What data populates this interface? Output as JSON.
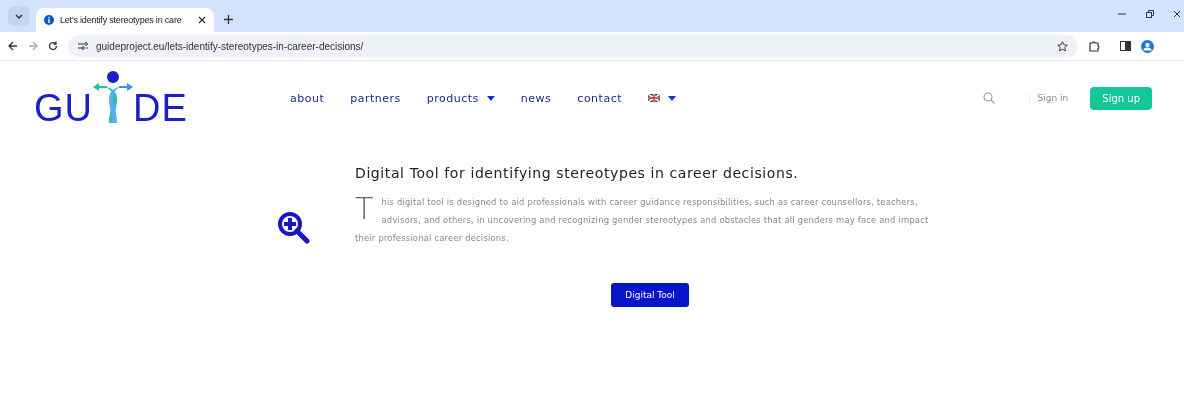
{
  "browser": {
    "tab_title": "Let's identify stereotypes in care",
    "url": "guideproject.eu/lets-identify-stereotypes-in-career-decisions/"
  },
  "logo": {
    "left": "GU",
    "right": "DE"
  },
  "nav": [
    {
      "label": "about",
      "dropdown": false
    },
    {
      "label": "partners",
      "dropdown": false
    },
    {
      "label": "products",
      "dropdown": true
    },
    {
      "label": "news",
      "dropdown": false
    },
    {
      "label": "contact",
      "dropdown": false
    }
  ],
  "auth": {
    "sign_in": "Sign in",
    "sign_up": "Sign up"
  },
  "content": {
    "title": "Digital Tool for identifying stereotypes in career decisions.",
    "paragraph": "This digital tool is designed to aid professionals with career guidance responsibilities, such as career counsellors, teachers, advisors, and others, in uncovering and recognizing gender stereotypes and obstacles that all genders may face and impact their professional career decisions.",
    "button": "Digital Tool"
  }
}
